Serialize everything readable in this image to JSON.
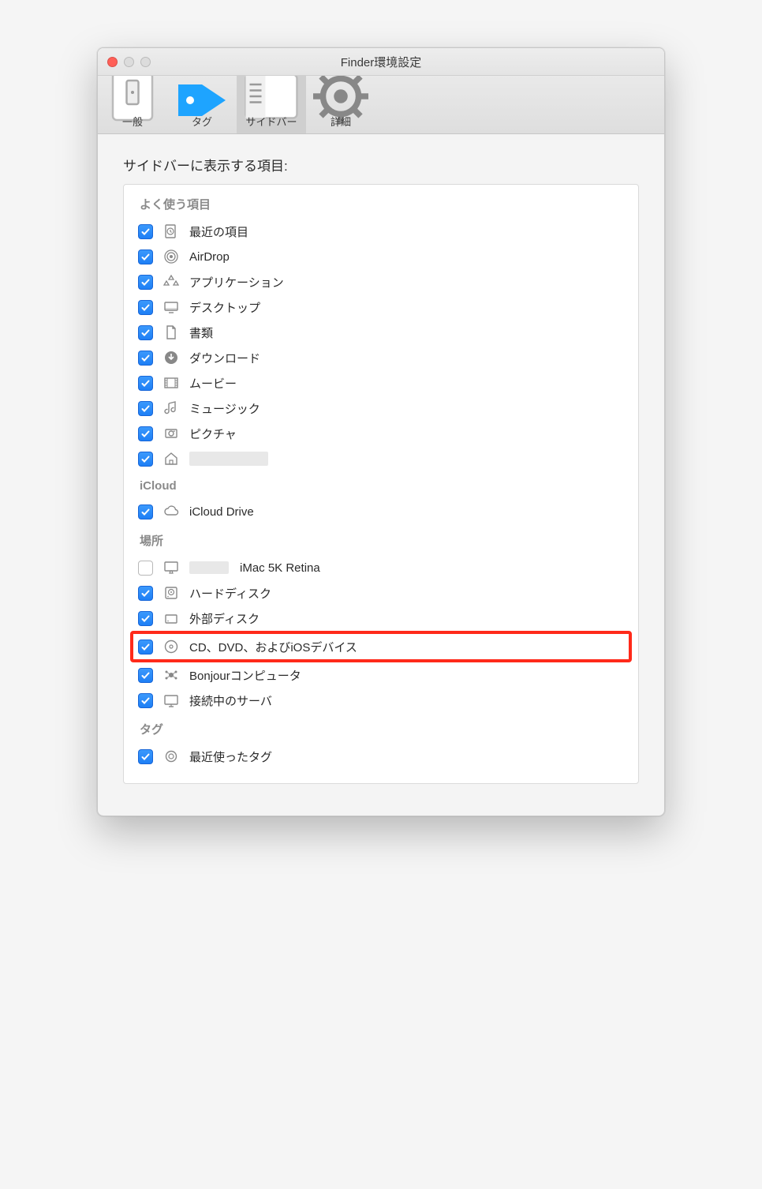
{
  "window": {
    "title": "Finder環境設定"
  },
  "toolbar": {
    "tabs": [
      {
        "id": "general",
        "label": "一般"
      },
      {
        "id": "tags",
        "label": "タグ"
      },
      {
        "id": "sidebar",
        "label": "サイドバー",
        "selected": true
      },
      {
        "id": "advanced",
        "label": "詳細"
      }
    ]
  },
  "heading": "サイドバーに表示する項目:",
  "sections": [
    {
      "title": "よく使う項目",
      "items": [
        {
          "id": "recents",
          "label": "最近の項目",
          "checked": true,
          "icon": "clock-doc"
        },
        {
          "id": "airdrop",
          "label": "AirDrop",
          "checked": true,
          "icon": "airdrop"
        },
        {
          "id": "apps",
          "label": "アプリケーション",
          "checked": true,
          "icon": "apps"
        },
        {
          "id": "desktop",
          "label": "デスクトップ",
          "checked": true,
          "icon": "desktop"
        },
        {
          "id": "documents",
          "label": "書類",
          "checked": true,
          "icon": "document"
        },
        {
          "id": "downloads",
          "label": "ダウンロード",
          "checked": true,
          "icon": "download"
        },
        {
          "id": "movies",
          "label": "ムービー",
          "checked": true,
          "icon": "movie"
        },
        {
          "id": "music",
          "label": "ミュージック",
          "checked": true,
          "icon": "music"
        },
        {
          "id": "pictures",
          "label": "ピクチャ",
          "checked": true,
          "icon": "picture"
        },
        {
          "id": "home",
          "label": "",
          "checked": true,
          "icon": "home",
          "redacted": true
        }
      ]
    },
    {
      "title": "iCloud",
      "items": [
        {
          "id": "iclouddrive",
          "label": "iCloud Drive",
          "checked": true,
          "icon": "cloud"
        }
      ]
    },
    {
      "title": "場所",
      "items": [
        {
          "id": "thismac",
          "label": "iMac 5K Retina",
          "checked": false,
          "icon": "imac",
          "prefixRedact": true
        },
        {
          "id": "hdd",
          "label": "ハードディスク",
          "checked": true,
          "icon": "hdd"
        },
        {
          "id": "extdisk",
          "label": "外部ディスク",
          "checked": true,
          "icon": "extdisk"
        },
        {
          "id": "optical",
          "label": "CD、DVD、およびiOSデバイス",
          "checked": true,
          "icon": "disc",
          "highlight": true
        },
        {
          "id": "bonjour",
          "label": "Bonjourコンピュータ",
          "checked": true,
          "icon": "bonjour"
        },
        {
          "id": "servers",
          "label": "接続中のサーバ",
          "checked": true,
          "icon": "server"
        }
      ]
    },
    {
      "title": "タグ",
      "items": [
        {
          "id": "recenttags",
          "label": "最近使ったタグ",
          "checked": true,
          "icon": "tag"
        }
      ]
    }
  ]
}
